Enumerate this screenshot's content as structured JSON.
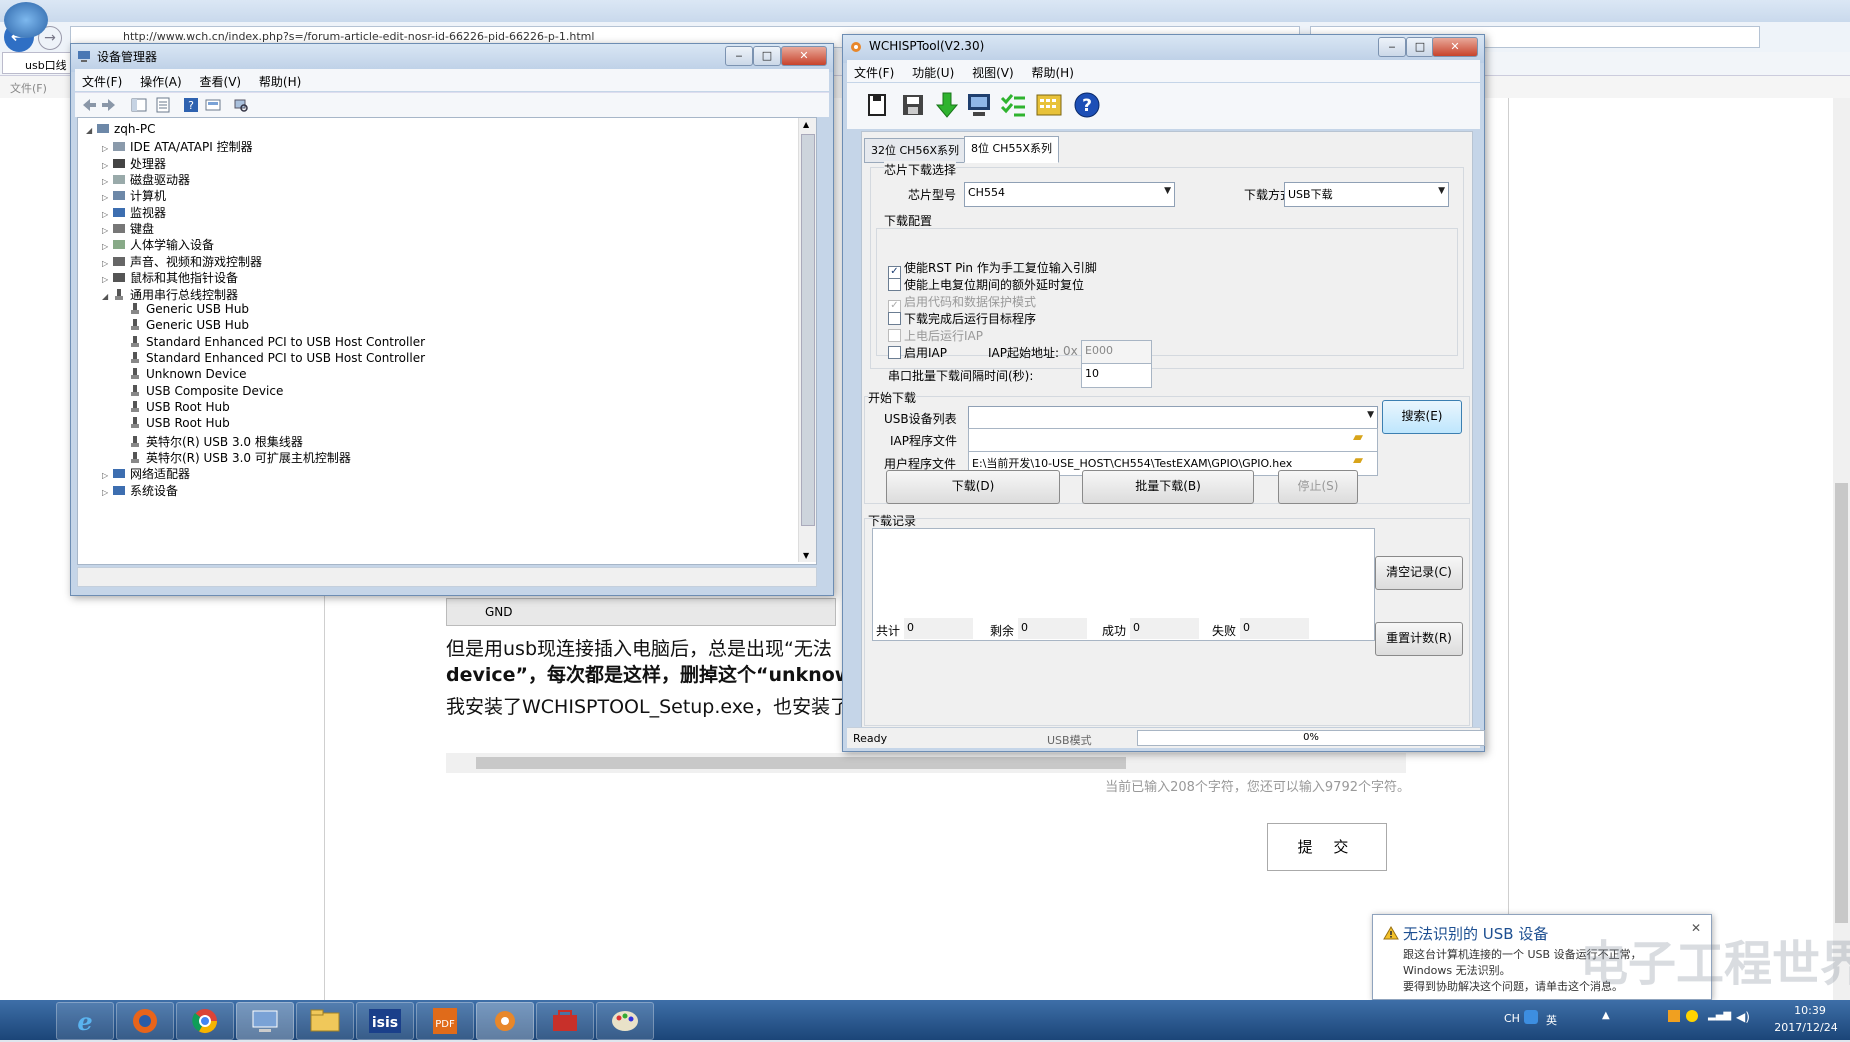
{
  "browser": {
    "url": "http://www.wch.cn/index.php?s=/forum-article-edit-nosr-id-66226-pid-66226-p-1.html",
    "tab_label": "usb口线",
    "menu_partial": "文件(F)",
    "gnd_label": "GND",
    "para_lines": [
      "但是用usb现连接插入电脑后，总是出现“无法",
      "device”，每次都是这样，删掉这个“unknow d",
      "我安装了WCHISPTOOL_Setup.exe，也安装了"
    ],
    "char_count": "当前已输入208个字符，您还可以输入9792个字符。",
    "submit": "提 交"
  },
  "device_manager": {
    "title": "设备管理器",
    "menu": [
      "文件(F)",
      "操作(A)",
      "查看(V)",
      "帮助(H)"
    ],
    "controls": {
      "min": "‒",
      "max": "□",
      "close": "✕"
    },
    "tree": [
      {
        "label": "zqh-PC",
        "level": 0,
        "expander": "◢",
        "icon": "computer-icon"
      },
      {
        "label": "IDE ATA/ATAPI 控制器",
        "level": 1,
        "expander": "▷",
        "icon": "ide-controller-icon"
      },
      {
        "label": "处理器",
        "level": 1,
        "expander": "▷",
        "icon": "processor-icon"
      },
      {
        "label": "磁盘驱动器",
        "level": 1,
        "expander": "▷",
        "icon": "disk-drive-icon"
      },
      {
        "label": "计算机",
        "level": 1,
        "expander": "▷",
        "icon": "computer-icon"
      },
      {
        "label": "监视器",
        "level": 1,
        "expander": "▷",
        "icon": "monitor-icon"
      },
      {
        "label": "键盘",
        "level": 1,
        "expander": "▷",
        "icon": "keyboard-icon"
      },
      {
        "label": "人体学输入设备",
        "level": 1,
        "expander": "▷",
        "icon": "hid-icon"
      },
      {
        "label": "声音、视频和游戏控制器",
        "level": 1,
        "expander": "▷",
        "icon": "sound-icon"
      },
      {
        "label": "鼠标和其他指针设备",
        "level": 1,
        "expander": "▷",
        "icon": "mouse-icon"
      },
      {
        "label": "通用串行总线控制器",
        "level": 1,
        "expander": "◢",
        "icon": "usb-icon"
      },
      {
        "label": "Generic USB Hub",
        "level": 2,
        "expander": "",
        "icon": "usb-icon"
      },
      {
        "label": "Generic USB Hub",
        "level": 2,
        "expander": "",
        "icon": "usb-icon"
      },
      {
        "label": "Standard Enhanced PCI to USB Host Controller",
        "level": 2,
        "expander": "",
        "icon": "usb-icon"
      },
      {
        "label": "Standard Enhanced PCI to USB Host Controller",
        "level": 2,
        "expander": "",
        "icon": "usb-icon"
      },
      {
        "label": "Unknown Device",
        "level": 2,
        "expander": "",
        "icon": "usb-icon"
      },
      {
        "label": "USB Composite Device",
        "level": 2,
        "expander": "",
        "icon": "usb-icon"
      },
      {
        "label": "USB Root Hub",
        "level": 2,
        "expander": "",
        "icon": "usb-icon"
      },
      {
        "label": "USB Root Hub",
        "level": 2,
        "expander": "",
        "icon": "usb-icon"
      },
      {
        "label": "英特尔(R) USB 3.0 根集线器",
        "level": 2,
        "expander": "",
        "icon": "usb-icon"
      },
      {
        "label": "英特尔(R) USB 3.0 可扩展主机控制器",
        "level": 2,
        "expander": "",
        "icon": "usb-icon"
      },
      {
        "label": "网络适配器",
        "level": 1,
        "expander": "▷",
        "icon": "network-icon"
      },
      {
        "label": "系统设备",
        "level": 1,
        "expander": "▷",
        "icon": "system-icon"
      }
    ]
  },
  "wchisp": {
    "title": "WCHISPTool(V2.30)",
    "menu": [
      "文件(F)",
      "功能(U)",
      "视图(V)",
      "帮助(H)"
    ],
    "tabs": [
      "32位 CH56X系列",
      "8位 CH55X系列"
    ],
    "chip_section": "芯片下载选择",
    "chip_model_label": "芯片型号",
    "chip_model_value": "CH554",
    "download_mode_label": "下载方式",
    "download_mode_value": "USB下载",
    "config_section": "下载配置",
    "options": [
      {
        "label": "使能RST Pin 作为手工复位输入引脚",
        "checked": true,
        "disabled": false
      },
      {
        "label": "使能上电复位期间的额外延时复位",
        "checked": false,
        "disabled": false
      },
      {
        "label": "启用代码和数据保护模式",
        "checked": true,
        "disabled": true
      },
      {
        "label": "下载完成后运行目标程序",
        "checked": false,
        "disabled": false
      },
      {
        "label": "上电后运行IAP",
        "checked": false,
        "disabled": true
      },
      {
        "label": "启用IAP",
        "checked": false,
        "disabled": false
      }
    ],
    "iap_addr_label": "IAP起始地址:",
    "iap_addr_prefix": "0x",
    "iap_addr_value": "E000",
    "interval_label": "串口批量下载间隔时间(秒):",
    "interval_value": "10",
    "start_section": "开始下载",
    "usb_list_label": "USB设备列表",
    "search_button": "搜索(E)",
    "iap_file_label": "IAP程序文件",
    "user_file_label": "用户程序文件",
    "user_file_value": "E:\\当前开发\\10-USE_HOST\\CH554\\TestEXAM\\GPIO\\GPIO.hex",
    "download_button": "下载(D)",
    "batch_button": "批量下载(B)",
    "stop_button": "停止(S)",
    "log_section": "下载记录",
    "clear_button": "清空记录(C)",
    "reset_button": "重置计数(R)",
    "counters": [
      {
        "label": "共计",
        "value": "0"
      },
      {
        "label": "剩余",
        "value": "0"
      },
      {
        "label": "成功",
        "value": "0"
      },
      {
        "label": "失败",
        "value": "0"
      }
    ],
    "status_ready": "Ready",
    "status_mode": "USB模式",
    "progress_percent": 0,
    "progress_text": "0%"
  },
  "notification": {
    "title": "无法识别的 USB 设备",
    "lines": [
      "跟这台计算机连接的一个 USB 设备运行不正常，",
      "Windows 无法识别。",
      "要得到协助解决这个问题，请单击这个消息。"
    ],
    "close": "✕"
  },
  "watermark": "电子工程世界",
  "taskbar": {
    "lang": "CH",
    "ime": "英",
    "time": "10:39",
    "date": "2017/12/24"
  },
  "colors": {
    "accent": "#1d4f91",
    "taskbar": "#1b4578",
    "progress": "#32b432",
    "folder": "#d8a41a"
  }
}
